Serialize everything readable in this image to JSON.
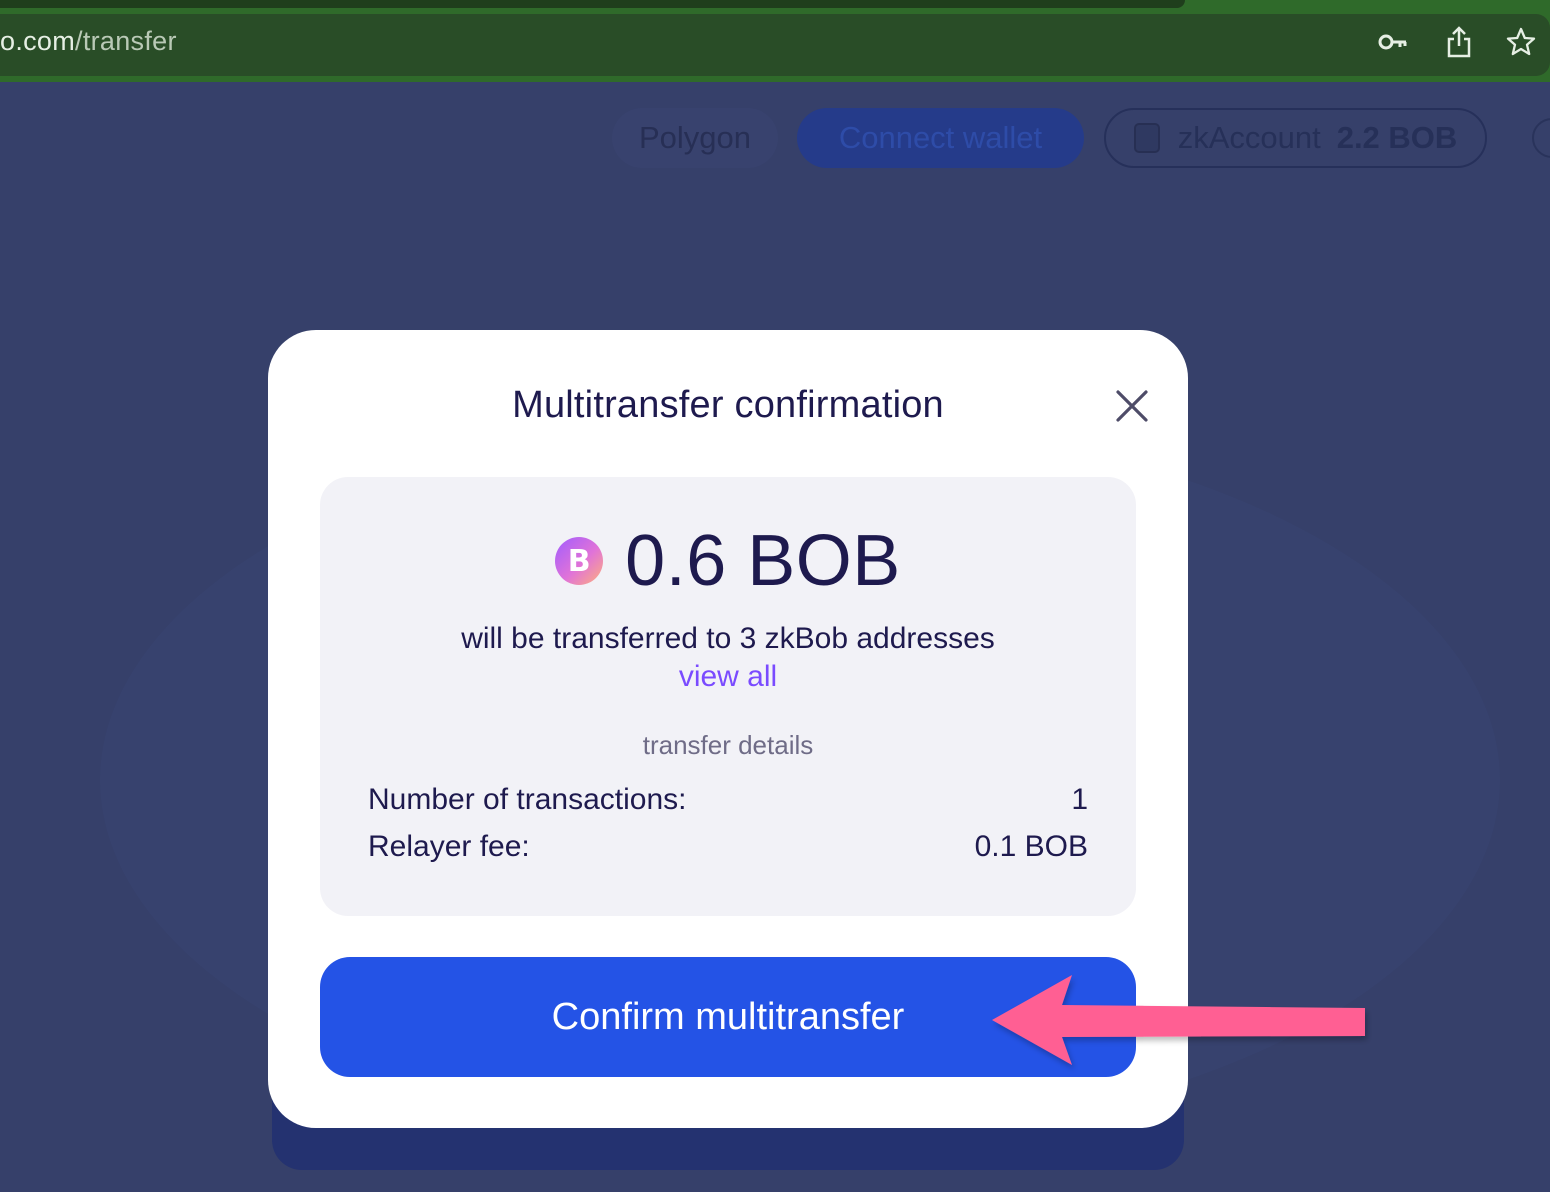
{
  "browser": {
    "url_host_fragment": "o.com",
    "url_path": "/transfer",
    "icons": [
      "key-icon",
      "share-icon",
      "star-icon"
    ]
  },
  "header": {
    "network": "Polygon",
    "connect_wallet": "Connect wallet",
    "account_label": "zkAccount",
    "account_balance": "2.2 BOB"
  },
  "modal": {
    "title": "Multitransfer confirmation",
    "close_icon": "close-icon",
    "token_icon": "bob-token-icon",
    "token_glyph": "B",
    "amount": "0.6 BOB",
    "note": "will be transferred to 3 zkBob addresses",
    "view_all": "view all",
    "details_label": "transfer details",
    "details": [
      {
        "label": "Number of transactions:",
        "value": "1"
      },
      {
        "label": "Relayer fee:",
        "value": "0.1 BOB"
      }
    ],
    "confirm_button": "Confirm multitransfer"
  },
  "colors": {
    "overlay_bg": "#36406a",
    "primary_button": "#2453e6",
    "link": "#7a4bff",
    "text_dark": "#1e1a4e",
    "annotation_arrow": "#ff5f93"
  }
}
